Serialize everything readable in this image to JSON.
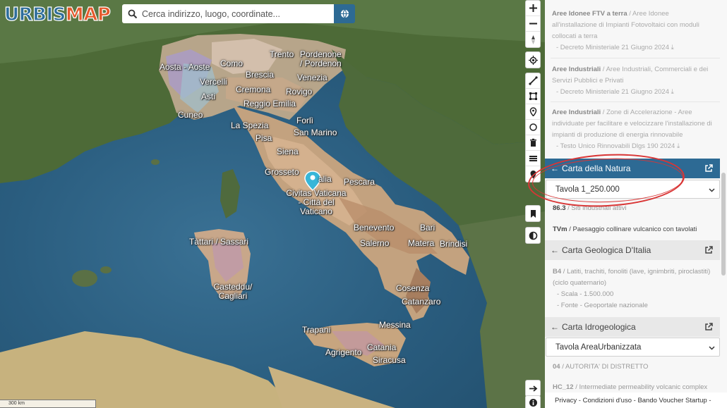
{
  "logo": {
    "part1": "URBIS",
    "part2": "MAP"
  },
  "search": {
    "placeholder": "Cerca indirizzo, luogo, coordinate..."
  },
  "toolbar": {
    "group1": [
      "zoom-in-icon",
      "zoom-out-icon",
      "compass-icon"
    ],
    "group2": [
      "locate-icon",
      "measure-line-icon",
      "draw-square-icon",
      "marker-icon",
      "circle-icon",
      "trash-icon",
      "layers-stack-icon",
      "pin-icon",
      "bookmark-icon",
      "contrast-icon"
    ],
    "bottom": [
      "arrow-right-icon",
      "info-icon"
    ]
  },
  "map": {
    "scale_label": "300 km",
    "cities": {
      "trento": "Trento",
      "pordenone": "Pordenone\n/ Pordenon",
      "aosta": "Aosta - Aoste",
      "como": "Como",
      "brescia": "Brescia",
      "venezia": "Venezia",
      "vercelli": "Vercelli",
      "cremona": "Cremona",
      "rovigo": "Rovigo",
      "asti": "Asti",
      "reggio": "Reggio Emilia",
      "cuneo": "Cuneo",
      "forli": "Forlì",
      "laspezia": "La Spezia",
      "sanmarino": "San Marino",
      "pisa": "Pisa",
      "siena": "Siena",
      "grosseto": "Grosseto",
      "rieti": "alia",
      "pescara": "Pescara",
      "civitas": "Civitas Vaticana\n- Città del\nVaticano",
      "benevento": "Benevento",
      "bari": "Bari",
      "salerno": "Salerno",
      "matera": "Matera",
      "brindisi": "Brindisi",
      "tattari": "Tàttari / Sassari",
      "casteddu": "Casteddu/\nCagliari",
      "cosenza": "Cosenza",
      "catanzaro": "Catanzaro",
      "messina": "Messina",
      "trapani": "Trapani",
      "catania": "Catania",
      "agrigento": "Agrigento",
      "siracusa": "Siracusa"
    }
  },
  "sidebar": {
    "items": [
      {
        "title": "Aree Idonee FTV a terra",
        "desc": " / Aree Idonee all'installazione di Impianti Fotovoltaici con moduli collocati a terra",
        "source": "- Decreto Ministeriale 21 Giugno 2024"
      },
      {
        "title": "Aree Industriali",
        "desc": " / Aree Industriali, Commerciali e dei Servizi Pubblici e Privati",
        "source": "- Decreto Ministeriale 21 Giugno 2024"
      },
      {
        "title": "Aree Industriali",
        "desc": " / Zone di Accelerazione - Aree individuate per facilitare e velocizzare l'installazione di impianti di produzione di energia rinnovabile",
        "source": "- Testo Unico Rinnovabili Dlgs 190 2024"
      }
    ],
    "sections": {
      "natura": {
        "title": "Carta della Natura",
        "select": "Tavola 1_250.000",
        "val1_code": "86.3",
        "val1_desc": " / Siti industriali attivi",
        "val2_code": "TVm",
        "val2_desc": " / Paesaggio collinare vulcanico con tavolati"
      },
      "geologica": {
        "title": "Carta Geologica D'Italia",
        "code": "B4",
        "desc": " / Latiti, trachiti, fonoliti (lave, ignimbriti, piroclastiti) (ciclo quaternario)",
        "scale": "- Scala - 1.500.000",
        "source": "- Fonte - Geoportale nazionale"
      },
      "idro": {
        "title": "Carta Idrogeologica",
        "select": "Tavola AreaUrbanizzata",
        "val1_code": "04",
        "val1_desc": " / AUTORITA' DI DISTRETTO",
        "val2_code": "HC_12",
        "val2_desc": " / Intermediate permeability volcanic complex"
      }
    }
  },
  "footer": {
    "text": "Privacy - Condizioni d'uso - Bando Voucher Startup -"
  },
  "colors": {
    "accent": "#2d6a94",
    "highlight": "#d93535",
    "logo_orange": "#e5592c",
    "logo_blue": "#2f6e9c"
  }
}
